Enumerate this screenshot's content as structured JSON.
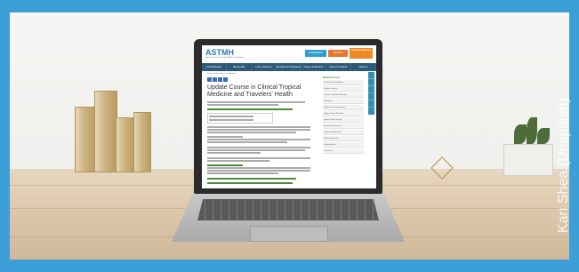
{
  "photo": {
    "credit": "Kari Shea (Unsplash)",
    "frame_color": "#3c9fd8"
  },
  "website": {
    "logo": "ASTMH",
    "tagline": "American Society of Tropical Medicine & Hygiene",
    "header_buttons": [
      {
        "label": "JOIN/RENEW",
        "color": "#2f9fd0"
      },
      {
        "label": "DONATE",
        "color": "#e8772e"
      },
      {
        "label": "ANNUAL MEETING",
        "color": "#f08a24"
      }
    ],
    "nav": [
      "Annual Meeting",
      "Membership",
      "Learn, Advance & Engage",
      "Education & Professional Development",
      "Careers & Research",
      "Pioneers & Awards",
      "About Us"
    ],
    "breadcrumb": "Home > Education > Certification",
    "page_title": "Update Course in Clinical Tropical Medicine and Travelers' Health",
    "sidebar_title": "Related Links",
    "sidebar_items": [
      "Certificate of Knowledge",
      "Diploma Courses",
      "Clinical Consultants Directory",
      "CTH Exam",
      "Update Course Information",
      "Update Course Schedule",
      "Update Course Faculty",
      "Exam Prep Resources",
      "Continuing Education",
      "Global Health Jobs",
      "Related Articles",
      "Contact Us"
    ],
    "rail_icons": [
      "person-icon",
      "email-icon",
      "heart-icon",
      "share-icon",
      "print-icon"
    ]
  }
}
